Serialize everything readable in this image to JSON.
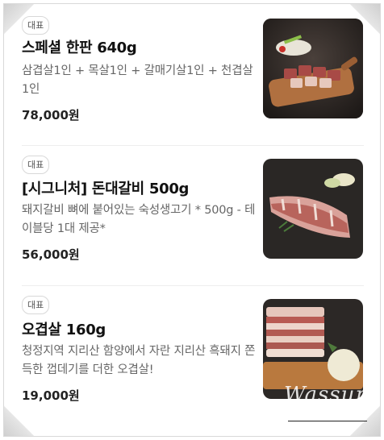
{
  "menu": {
    "items": [
      {
        "badge": "대표",
        "name": "스페셜 한판 640g",
        "description": "삼겹살1인 + 목살1인 + 갈매기살1인 + 천겹살1인",
        "price": "78,000원",
        "image_icon": "pork-platter-photo"
      },
      {
        "badge": "대표",
        "name": "[시그니처] 돈대갈비 500g",
        "description": "돼지갈비 뼈에 붙어있는 숙성생고기 * 500g - 테이블당 1대 제공*",
        "price": "56,000원",
        "image_icon": "pork-rib-photo"
      },
      {
        "badge": "대표",
        "name": "오겹살 160g",
        "description": "청정지역 지리산 함양에서 자란 지리산 흑돼지 쫀득한 껍데기를 더한 오겹살!",
        "price": "19,000원",
        "image_icon": "pork-belly-photo"
      }
    ]
  },
  "watermark": "Wassup"
}
